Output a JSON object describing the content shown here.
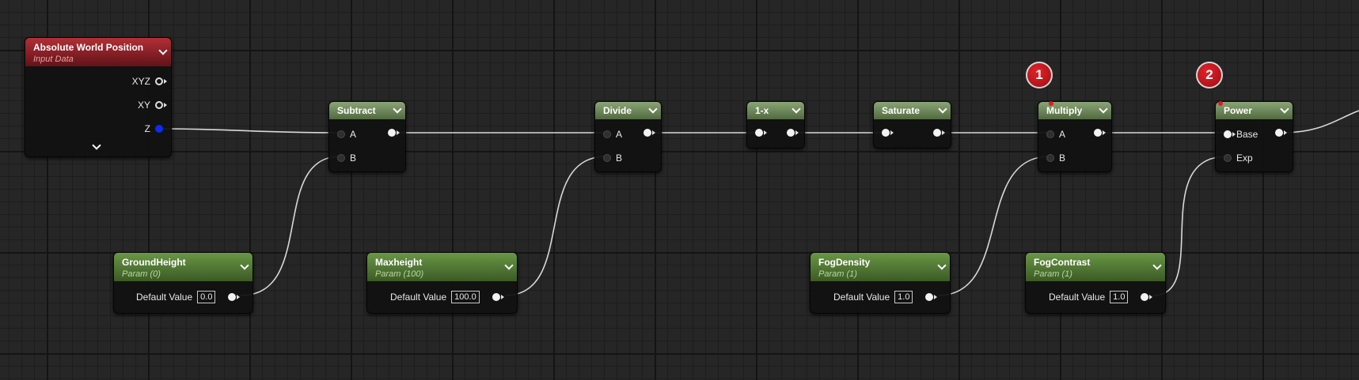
{
  "nodes": {
    "absolute_world_position": {
      "title": "Absolute World Position",
      "subtitle": "Input Data",
      "outputs": [
        "XYZ",
        "XY",
        "Z"
      ]
    },
    "subtract": {
      "title": "Subtract",
      "inputs": [
        "A",
        "B"
      ]
    },
    "divide": {
      "title": "Divide",
      "inputs": [
        "A",
        "B"
      ]
    },
    "one_minus": {
      "title": "1-x"
    },
    "saturate": {
      "title": "Saturate"
    },
    "multiply": {
      "title": "Multiply",
      "inputs": [
        "A",
        "B"
      ]
    },
    "power": {
      "title": "Power",
      "inputs": [
        "Base",
        "Exp"
      ]
    },
    "ground_height": {
      "title": "GroundHeight",
      "subtitle": "Param (0)",
      "field_label": "Default Value",
      "value": "0.0"
    },
    "maxheight": {
      "title": "Maxheight",
      "subtitle": "Param (100)",
      "field_label": "Default Value",
      "value": "100.0"
    },
    "fog_density": {
      "title": "FogDensity",
      "subtitle": "Param (1)",
      "field_label": "Default Value",
      "value": "1.0"
    },
    "fog_contrast": {
      "title": "FogContrast",
      "subtitle": "Param (1)",
      "field_label": "Default Value",
      "value": "1.0"
    }
  },
  "markers": [
    "1",
    "2"
  ],
  "colors": {
    "math_header": "#6f8a5c",
    "param_header": "#4f7a33",
    "input_header": "#8a1f26",
    "wire": "#d9d9d9",
    "marker": "#c8151d",
    "z_pin": "#0b2cf7"
  }
}
